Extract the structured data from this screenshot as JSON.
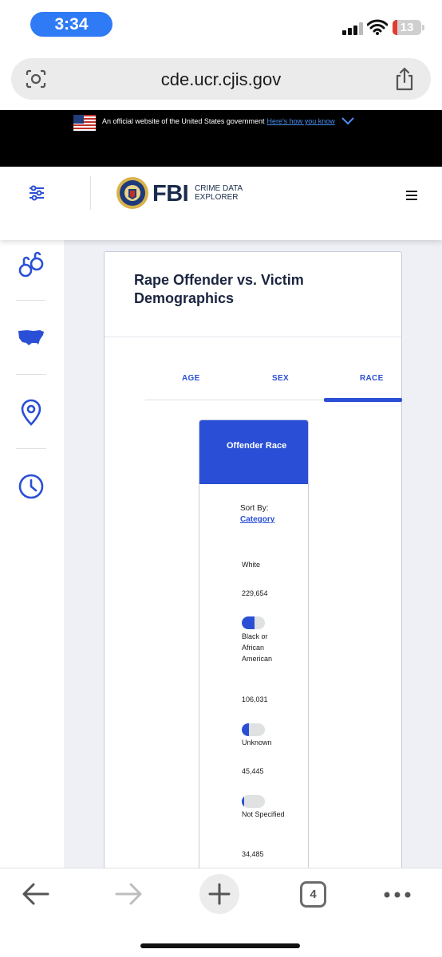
{
  "status_bar": {
    "time": "3:34",
    "battery": "13"
  },
  "browser": {
    "url": "cde.ucr.cjis.gov",
    "open_tabs": "4"
  },
  "gov_banner": {
    "text": "An official website of the United States government",
    "link": "Here's how you know"
  },
  "header": {
    "logo_fbi": "FBI",
    "logo_line1": "CRIME DATA",
    "logo_line2": "EXPLORER"
  },
  "card": {
    "title": "Rape Offender vs. Victim Demographics",
    "tabs": [
      {
        "label": "AGE",
        "active": false
      },
      {
        "label": "SEX",
        "active": false
      },
      {
        "label": "RACE",
        "active": true
      }
    ],
    "panel": {
      "heading": "Offender Race",
      "sort_label": "Sort By:",
      "sort_value": "Category",
      "rows": [
        {
          "label": "White",
          "count": "229,654",
          "share": null
        },
        {
          "label": "Black or African American",
          "count": "106,031",
          "share": 0.55
        },
        {
          "label": "Unknown",
          "count": "45,445",
          "share": 0.3
        },
        {
          "label": "Not Specified",
          "count": "34,485",
          "share": 0.1
        }
      ]
    }
  },
  "colors": {
    "accent": "#2a4fd6",
    "banner": "#000000",
    "page_bg": "#eef0f6",
    "time_pill": "#2f7bf5"
  }
}
